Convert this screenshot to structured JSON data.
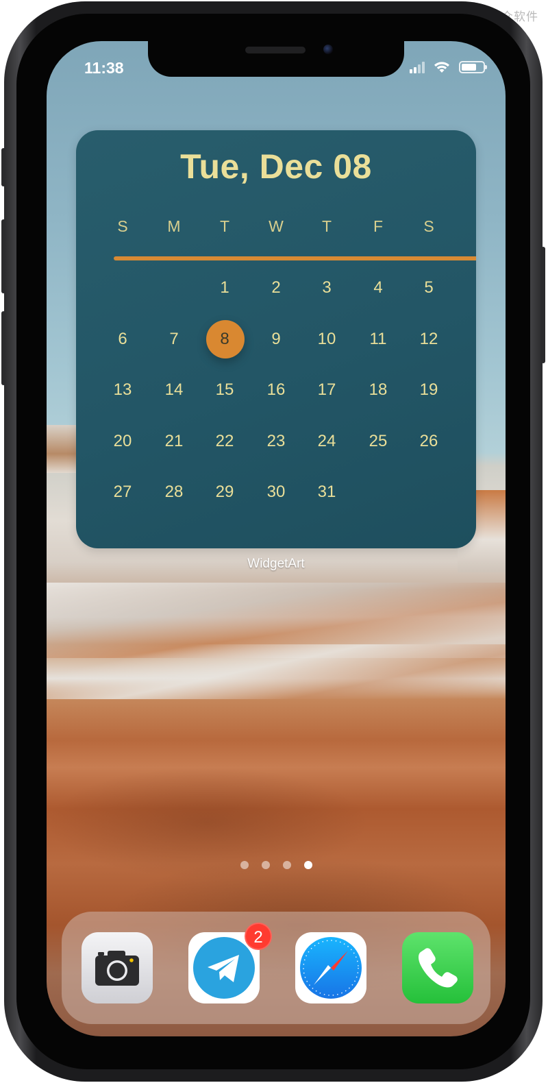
{
  "watermark": "小众软件",
  "status_bar": {
    "time": "11:38",
    "icons": [
      "cellular-signal-icon",
      "wifi-icon",
      "battery-icon"
    ],
    "battery_level": 0.7
  },
  "widget": {
    "app_name": "WidgetArt",
    "date_label": "Tue, Dec 08",
    "weekdays": [
      "S",
      "M",
      "T",
      "W",
      "T",
      "F",
      "S"
    ],
    "days": [
      "1",
      "2",
      "3",
      "4",
      "5",
      "6",
      "7",
      "8",
      "9",
      "10",
      "11",
      "12",
      "13",
      "14",
      "15",
      "16",
      "17",
      "18",
      "19",
      "20",
      "21",
      "22",
      "23",
      "24",
      "25",
      "26",
      "27",
      "28",
      "29",
      "30",
      "31"
    ],
    "first_weekday_index": 2,
    "today": "8",
    "colors": {
      "background": "#245868",
      "text": "#eadf99",
      "accent": "#d98831"
    }
  },
  "page_indicator": {
    "count": 4,
    "active_index": 3
  },
  "dock": {
    "apps": [
      {
        "name": "Camera",
        "icon": "camera-icon"
      },
      {
        "name": "Telegram",
        "icon": "telegram-icon",
        "badge": "2"
      },
      {
        "name": "Safari",
        "icon": "safari-icon"
      },
      {
        "name": "Phone",
        "icon": "phone-icon"
      }
    ]
  }
}
